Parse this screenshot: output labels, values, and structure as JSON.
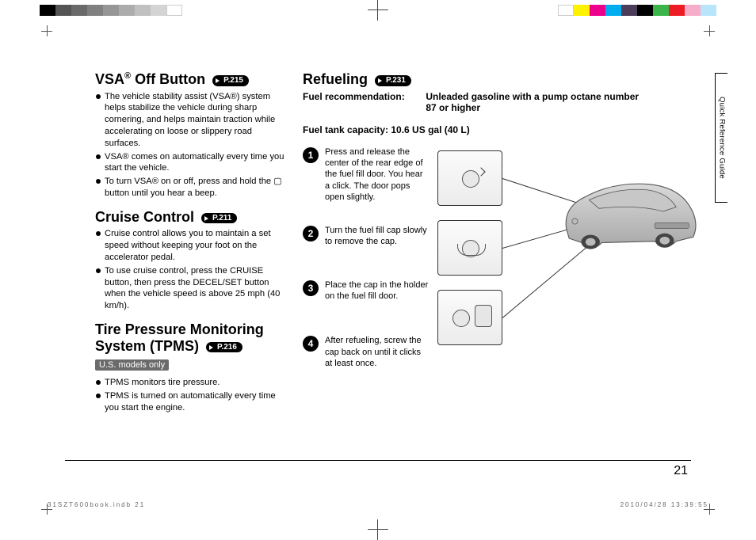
{
  "sideTab": "Quick Reference Guide",
  "pageNumber": "21",
  "footerLeft": "31SZT600book.indb   21",
  "footerRight": "2010/04/28   13:39:55",
  "left": {
    "sec1": {
      "title_pre": "VSA",
      "title_sup": "®",
      "title_post": " Off Button",
      "pref": "P.215",
      "bullets": [
        "The vehicle stability assist (VSA®) system helps stabilize the vehicle during sharp cornering, and helps maintain traction while accelerating on loose or slippery road surfaces.",
        "VSA® comes on automatically every time you start the vehicle.",
        "To turn VSA® on or off, press and hold the ▢ button until you hear a beep."
      ]
    },
    "sec2": {
      "title": "Cruise Control",
      "pref": "P.211",
      "bullets": [
        "Cruise control allows you to maintain a set speed without keeping your foot on the accelerator pedal.",
        "To use cruise control, press the CRUISE button, then press the DECEL/SET button when the vehicle speed is above 25 mph (40 km/h)."
      ]
    },
    "sec3": {
      "title": "Tire Pressure Monitoring System (TPMS)",
      "pref": "P.216",
      "badge": "U.S. models only",
      "bullets": [
        "TPMS monitors tire pressure.",
        "TPMS is turned on automatically every time you start the engine."
      ]
    }
  },
  "right": {
    "title": "Refueling",
    "pref": "P.231",
    "fuelRecLabel": "Fuel recommendation:",
    "fuelRecValue": "Unleaded gasoline with a pump octane number 87 or higher",
    "capLabel": "Fuel tank capacity: 10.6 US gal (40 L)",
    "steps": [
      {
        "n": "1",
        "t": "Press and release the center of the rear edge of the fuel fill door. You hear a click. The door pops open slightly."
      },
      {
        "n": "2",
        "t": "Turn the fuel fill cap slowly to remove the cap."
      },
      {
        "n": "3",
        "t": "Place the cap in the holder on the fuel fill door."
      },
      {
        "n": "4",
        "t": "After refueling, screw the cap back on until it clicks at least once."
      }
    ]
  }
}
